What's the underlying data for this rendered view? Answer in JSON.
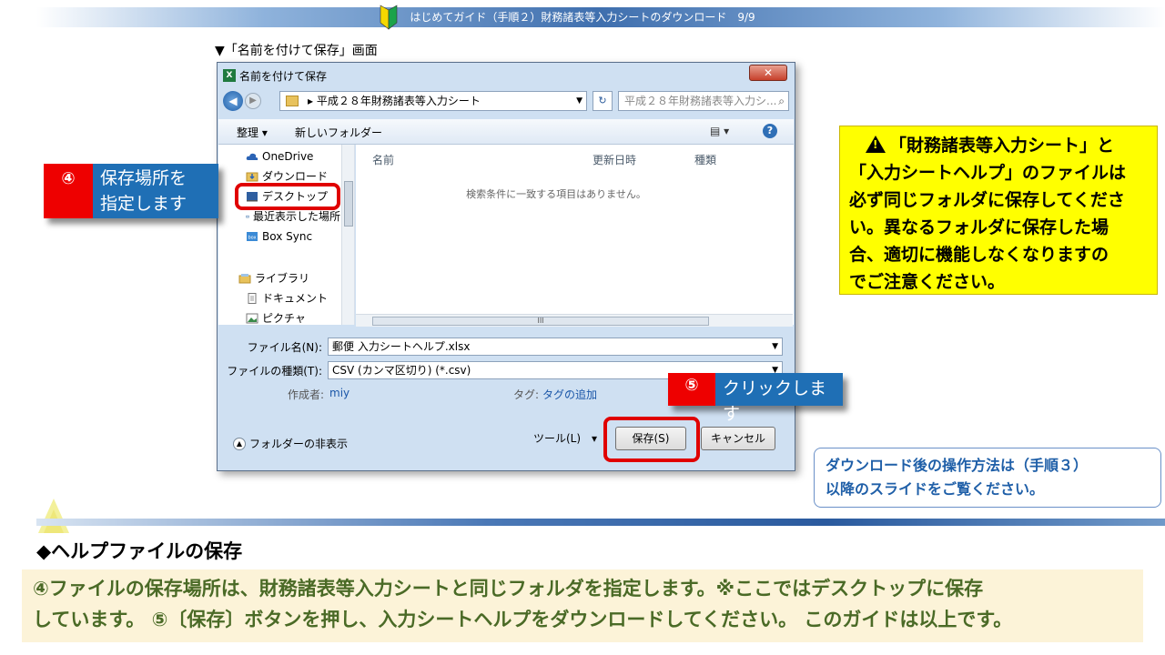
{
  "header": {
    "title": "はじめてガイド（手順２）財務諸表等入力シートのダウンロード　9/9"
  },
  "caption": "▼「名前を付けて保存」画面",
  "dialog": {
    "title": "名前を付けて保存",
    "close_glyph": "✕",
    "address_path": "▸ 平成２８年財務諸表等入力シート",
    "search_placeholder": "平成２８年財務諸表等入力シ...",
    "toolbar": {
      "organize": "整理 ▾",
      "new_folder": "新しいフォルダー",
      "view": "▤ ▾",
      "help": "?"
    },
    "nav_items": [
      "OneDrive",
      "ダウンロード",
      "デスクトップ",
      "最近表示した場所",
      "Box Sync",
      "ライブラリ",
      "ドキュメント",
      "ピクチャ"
    ],
    "columns": {
      "name": "名前",
      "date": "更新日時",
      "type": "種類"
    },
    "empty_message": "検索条件に一致する項目はありません。",
    "hscroll_label": "III",
    "file_name_label": "ファイル名(N):",
    "file_name_value": "郵便 入力シートヘルプ.xlsx",
    "file_type_label": "ファイルの種類(T):",
    "file_type_value": "CSV (カンマ区切り) (*.csv)",
    "author_label": "作成者:",
    "author_value": "miy",
    "tag_label": "タグ:",
    "tag_value": "タグの追加",
    "hide_folders": "フォルダーの非表示",
    "tools": "ツール(L)　▾",
    "save_button": "保存(S)",
    "cancel_button": "キャンセル"
  },
  "callouts": {
    "step4": {
      "num": "④",
      "text1": "保存場所を",
      "text2": "指定します"
    },
    "step5": {
      "num": "⑤",
      "text": "クリックします"
    }
  },
  "warning": {
    "line1": "「財務諸表等入力シート」と",
    "line2": "「入力シートヘルプ」のファイルは",
    "line3": "必ず同じフォルダに保存してくださ",
    "line4": "い。異なるフォルダに保存した場",
    "line5": "合、適切に機能しなくなりますの",
    "line6": "でご注意ください。"
  },
  "info": {
    "line1": "ダウンロード後の操作方法は（手順３）",
    "line2": "以降のスライドをご覧ください。"
  },
  "section_title": "◆ヘルプファイルの保存",
  "note": {
    "line1": "④ファイルの保存場所は、財務諸表等入力シートと同じフォルダを指定します。※ここではデスクトップに保存",
    "line2": "しています。 ⑤〔保存〕ボタンを押し、入力シートヘルプをダウンロードしてください。 このガイドは以上です。"
  },
  "colors": {
    "accent_blue": "#1f6fb5",
    "alert_red": "#ee0000",
    "warning_yellow": "#ffff00",
    "note_green": "#4a6a26"
  }
}
